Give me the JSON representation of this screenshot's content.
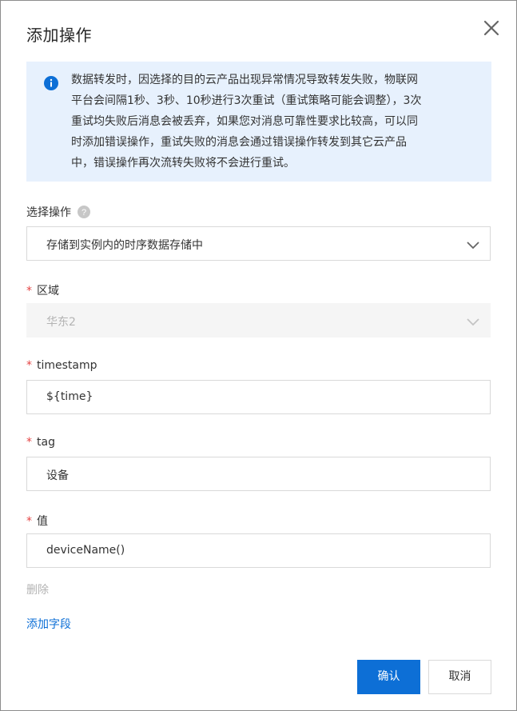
{
  "dialog": {
    "title": "添加操作",
    "close_icon": "close-icon"
  },
  "notice": {
    "icon": "info-icon",
    "lines": [
      "数据转发时，因选择的目的云产品出现异常情况导致转发失败，物联网",
      "平台会间隔1秒、3秒、10秒进行3次重试（重试策略可能会调整），3次",
      "重试均失败后消息会被丢弃，如果您对消息可靠性要求比较高，可以同",
      "时添加错误操作，重试失败的消息会通过错误操作转发到其它云产品",
      "中，错误操作再次流转失败将不会进行重试。"
    ]
  },
  "form": {
    "operation": {
      "label": "选择操作",
      "value": "存储到实例内的时序数据存储中",
      "help_icon": "question-circle-icon"
    },
    "region": {
      "label": "区域",
      "value": "华东2",
      "required": "*"
    },
    "timestamp": {
      "label": "timestamp",
      "value": "${time}",
      "required": "*"
    },
    "tag": {
      "label": "tag",
      "value": "设备",
      "required": "*"
    },
    "tag_value": {
      "label": "值",
      "value": "deviceName()",
      "required": "*"
    },
    "delete_link": "删除",
    "add_field_link": "添加字段"
  },
  "footer": {
    "confirm": "确认",
    "cancel": "取消"
  },
  "colors": {
    "primary": "#0d6fd6",
    "notice_bg": "#e7f1fd",
    "required": "#e54545",
    "link": "#0d6fd6",
    "disabled_text": "#b3b3b3"
  }
}
